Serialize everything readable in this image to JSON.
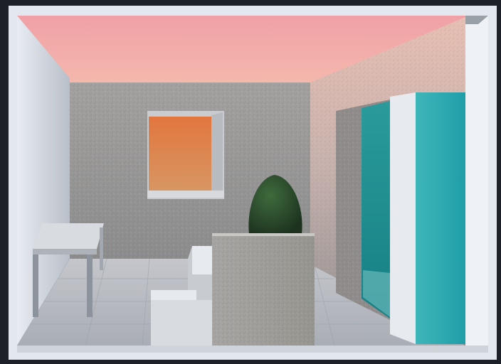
{
  "scene": {
    "colors": {
      "sky_top": "#f3a7a8",
      "sky_bottom": "#f5c1b3",
      "stucco": "#9a9894",
      "stucco_warm": "#d9b8ae",
      "frame": "#dfe3ea",
      "floor": "#b5b8bf",
      "window_glow": "#e0834a",
      "teal": "#2eaab0",
      "shrub": "#2b4a2c"
    },
    "elements": [
      "frame",
      "sky",
      "left-wall",
      "back-wall",
      "window",
      "shrub",
      "right-wall",
      "doorway",
      "teal-panel",
      "bench",
      "steps",
      "planter-block",
      "floor"
    ]
  }
}
